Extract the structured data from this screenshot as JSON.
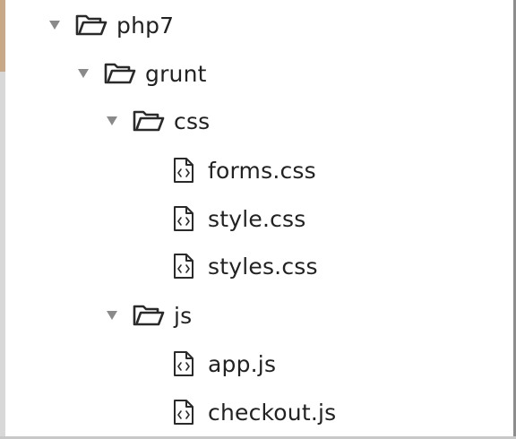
{
  "tree": {
    "root": {
      "label": "php7",
      "icon": "folder-open-icon",
      "expanded": true,
      "children": {
        "grunt": {
          "label": "grunt",
          "icon": "folder-open-icon",
          "expanded": true,
          "children": {
            "css": {
              "label": "css",
              "icon": "folder-open-icon",
              "expanded": true,
              "files": [
                {
                  "label": "forms.css",
                  "icon": "code-file-icon"
                },
                {
                  "label": "style.css",
                  "icon": "code-file-icon"
                },
                {
                  "label": "styles.css",
                  "icon": "code-file-icon"
                }
              ]
            },
            "js": {
              "label": "js",
              "icon": "folder-open-icon",
              "expanded": true,
              "files": [
                {
                  "label": "app.js",
                  "icon": "code-file-icon"
                },
                {
                  "label": "checkout.js",
                  "icon": "code-file-icon"
                }
              ]
            }
          }
        }
      }
    }
  },
  "colors": {
    "text": "#222222",
    "icon_stroke": "#2a2a2a",
    "twisty": "#8a8a8a",
    "left_strip": "#d8d8d8",
    "left_accent": "#c9a888",
    "right_border": "#8d8d8d"
  }
}
